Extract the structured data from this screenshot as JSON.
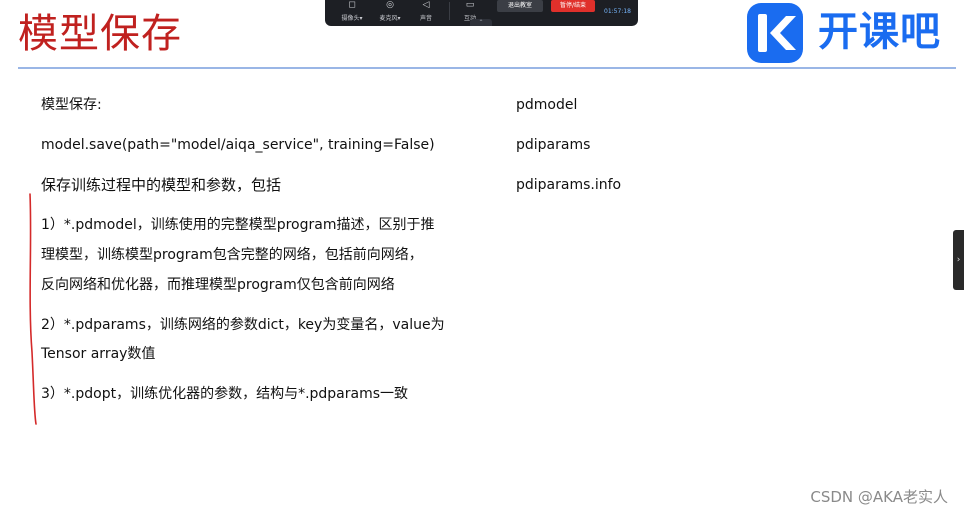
{
  "slide": {
    "title": "模型保存"
  },
  "meeting_bar": {
    "items": [
      {
        "icon": "camera-icon",
        "glyph": "◻",
        "label": "摄像头▾"
      },
      {
        "icon": "microphone-icon",
        "glyph": "◎",
        "label": "麦克风▾"
      },
      {
        "icon": "speaker-icon",
        "glyph": "◁",
        "label": "声音"
      },
      {
        "icon": "interaction-icon",
        "glyph": "▭",
        "label": "互动"
      }
    ],
    "exit_label": "退出教室",
    "end_label": "暂停/结束",
    "time": "01:57:18",
    "handle_glyph": "⌃"
  },
  "logo": {
    "text": "开课吧",
    "color": "#1a6cf0"
  },
  "left_column": {
    "heading": "模型保存:",
    "code_line": "model.save(path=\"model/aiqa_service\", training=False)",
    "intro": "保存训练过程中的模型和参数，包括",
    "item1": [
      "1）*.pdmodel，训练使用的完整模型program描述，区别于推",
      "理模型，训练模型program包含完整的网络，包括前向网络，",
      "反向网络和优化器，而推理模型program仅包含前向网络"
    ],
    "item2": [
      "2）*.pdparams，训练网络的参数dict，key为变量名，value为",
      "Tensor array数值"
    ],
    "item3": "3）*.pdopt，训练优化器的参数，结构与*.pdparams一致"
  },
  "right_column": {
    "files": [
      "pdmodel",
      "pdiparams",
      "pdiparams.info"
    ]
  },
  "side_tab": {
    "icon": "chevron-right-icon",
    "glyph": "›"
  },
  "watermark": "CSDN @AKA老实人",
  "colors": {
    "title": "#c0211f",
    "rule": "#9ab6e6",
    "annotation": "#d42a2a"
  }
}
